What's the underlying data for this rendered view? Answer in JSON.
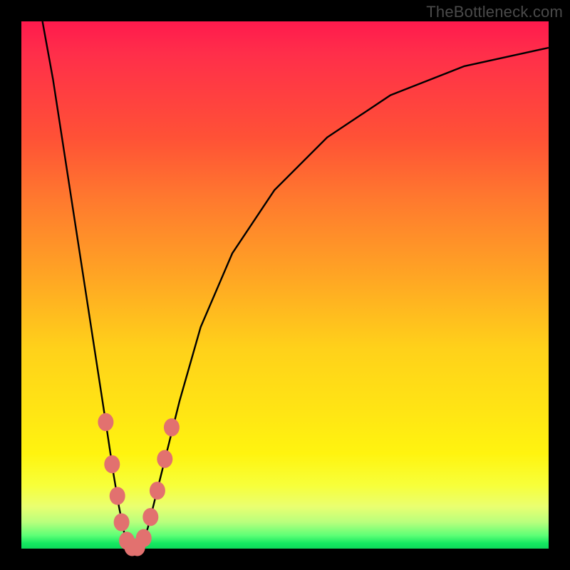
{
  "watermark": "TheBottleneck.com",
  "colors": {
    "frame": "#000000",
    "curve": "#000000",
    "marker": "#e2716f",
    "gradient_top": "#ff1a4d",
    "gradient_bottom": "#0fd85b"
  },
  "chart_data": {
    "type": "line",
    "title": "",
    "xlabel": "",
    "ylabel": "",
    "xlim": [
      0,
      100
    ],
    "ylim": [
      0,
      100
    ],
    "annotations": [
      "TheBottleneck.com"
    ],
    "series": [
      {
        "name": "bottleneck-curve",
        "x": [
          4,
          6,
          8,
          10,
          12,
          14,
          16,
          17.5,
          18.5,
          19.5,
          20.5,
          21.5,
          22,
          23,
          24,
          25,
          27,
          30,
          34,
          40,
          48,
          58,
          70,
          84,
          100
        ],
        "values": [
          100,
          89,
          76,
          63,
          50,
          37,
          24,
          14,
          8,
          3,
          0.5,
          0,
          0,
          1,
          4,
          8,
          16,
          28,
          42,
          56,
          68,
          78,
          86,
          91.5,
          95
        ]
      }
    ],
    "markers": [
      {
        "x": 16.0,
        "y": 24
      },
      {
        "x": 17.2,
        "y": 16
      },
      {
        "x": 18.2,
        "y": 10
      },
      {
        "x": 19.0,
        "y": 5
      },
      {
        "x": 20.0,
        "y": 1.5
      },
      {
        "x": 21.0,
        "y": 0.3
      },
      {
        "x": 22.0,
        "y": 0.3
      },
      {
        "x": 23.2,
        "y": 2
      },
      {
        "x": 24.5,
        "y": 6
      },
      {
        "x": 25.8,
        "y": 11
      },
      {
        "x": 27.2,
        "y": 17
      },
      {
        "x": 28.5,
        "y": 23
      }
    ]
  }
}
